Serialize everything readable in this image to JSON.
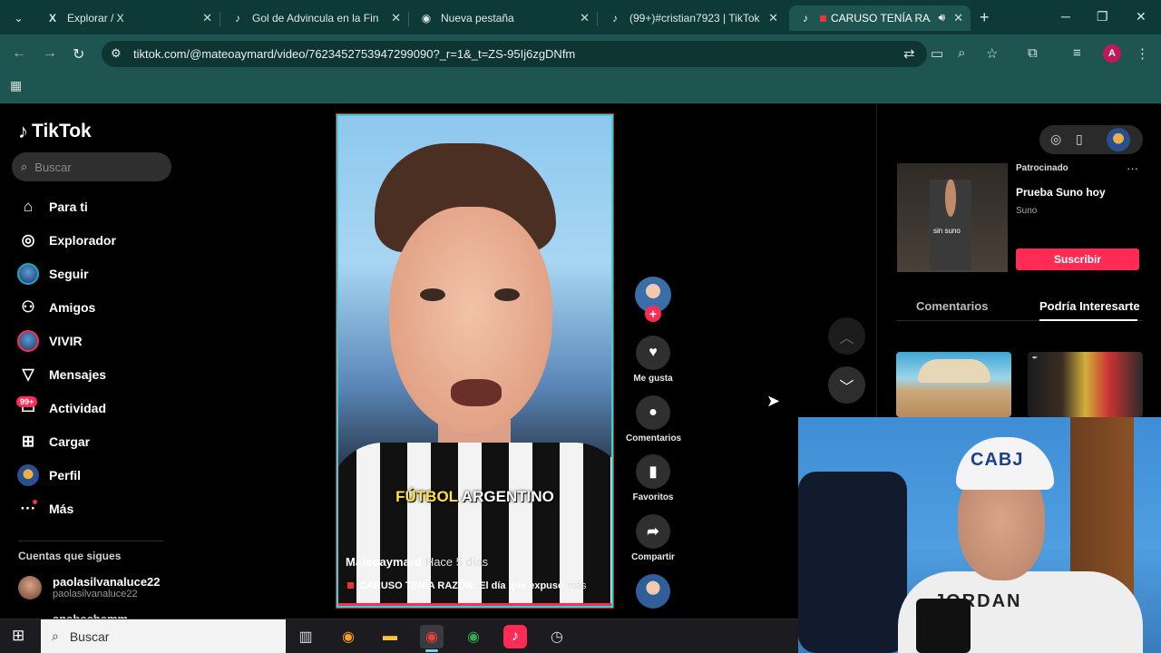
{
  "browser": {
    "tabs": [
      {
        "title": "Explorar / X",
        "icon": "x-logo-icon",
        "active": false
      },
      {
        "title": "Gol de Advincula en la Final",
        "icon": "tiktok-icon",
        "active": false
      },
      {
        "title": "Nueva pestaña",
        "icon": "chrome-icon",
        "active": false
      },
      {
        "title": "(99+)#cristian7923 | TikTok",
        "icon": "tiktok-icon",
        "active": false
      },
      {
        "title": "CARUSO TENÍA RAZÓ",
        "icon": "tiktok-icon",
        "active": true
      }
    ],
    "url": "tiktok.com/@mateoaymard/video/7623452753947299090?_r=1&_t=ZS-95Ij6zgDNfm",
    "profile_initial": "A"
  },
  "sidebar": {
    "logo": "TikTok",
    "search_placeholder": "Buscar",
    "nav": [
      {
        "label": "Para ti",
        "icon": "home-icon"
      },
      {
        "label": "Explorador",
        "icon": "compass-icon"
      },
      {
        "label": "Seguir",
        "icon": "following-avatar-icon"
      },
      {
        "label": "Amigos",
        "icon": "friends-icon"
      },
      {
        "label": "VIVIR",
        "icon": "live-avatar-icon"
      },
      {
        "label": "Mensajes",
        "icon": "send-icon"
      },
      {
        "label": "Actividad",
        "icon": "inbox-icon"
      },
      {
        "label": "Cargar",
        "icon": "upload-icon"
      },
      {
        "label": "Perfil",
        "icon": "profile-avatar-icon"
      },
      {
        "label": "Más",
        "icon": "more-icon"
      }
    ],
    "activity_badge": "99+",
    "following_title": "Cuentas que sigues",
    "following": [
      {
        "name": "paolasilvanaluce22",
        "handle": "paolasilvanaluce22"
      }
    ],
    "following_partial": "anabechemm"
  },
  "video": {
    "caption_highlight": "FÚTBOL",
    "caption_rest": "ARGENTINO",
    "author": "Mateoaymard",
    "time": "Hace 5 días",
    "description": "CARUSO TENÍA RAZÓN: El día que expuso",
    "more_label": "más",
    "progress": 1.0
  },
  "actions": {
    "like": "Me gusta",
    "comments": "Comentarios",
    "favorites": "Favoritos",
    "share": "Compartir"
  },
  "ad": {
    "label": "Patrocinado",
    "title": "Prueba Suno hoy",
    "brand": "Suno",
    "watermark": "sin suno",
    "cta": "Suscribir"
  },
  "right_tabs": [
    "Comentarios",
    "Podría Interesarte"
  ],
  "right_tab_active": 1,
  "webcam": {
    "cap_text": "CABJ",
    "shirt_text": "JORDAN"
  },
  "taskbar": {
    "search_placeholder": "Buscar"
  },
  "colors": {
    "tiktok_red": "#fe2c55",
    "chrome_frame": "#1e5550",
    "video_border": "#30d5d9"
  }
}
